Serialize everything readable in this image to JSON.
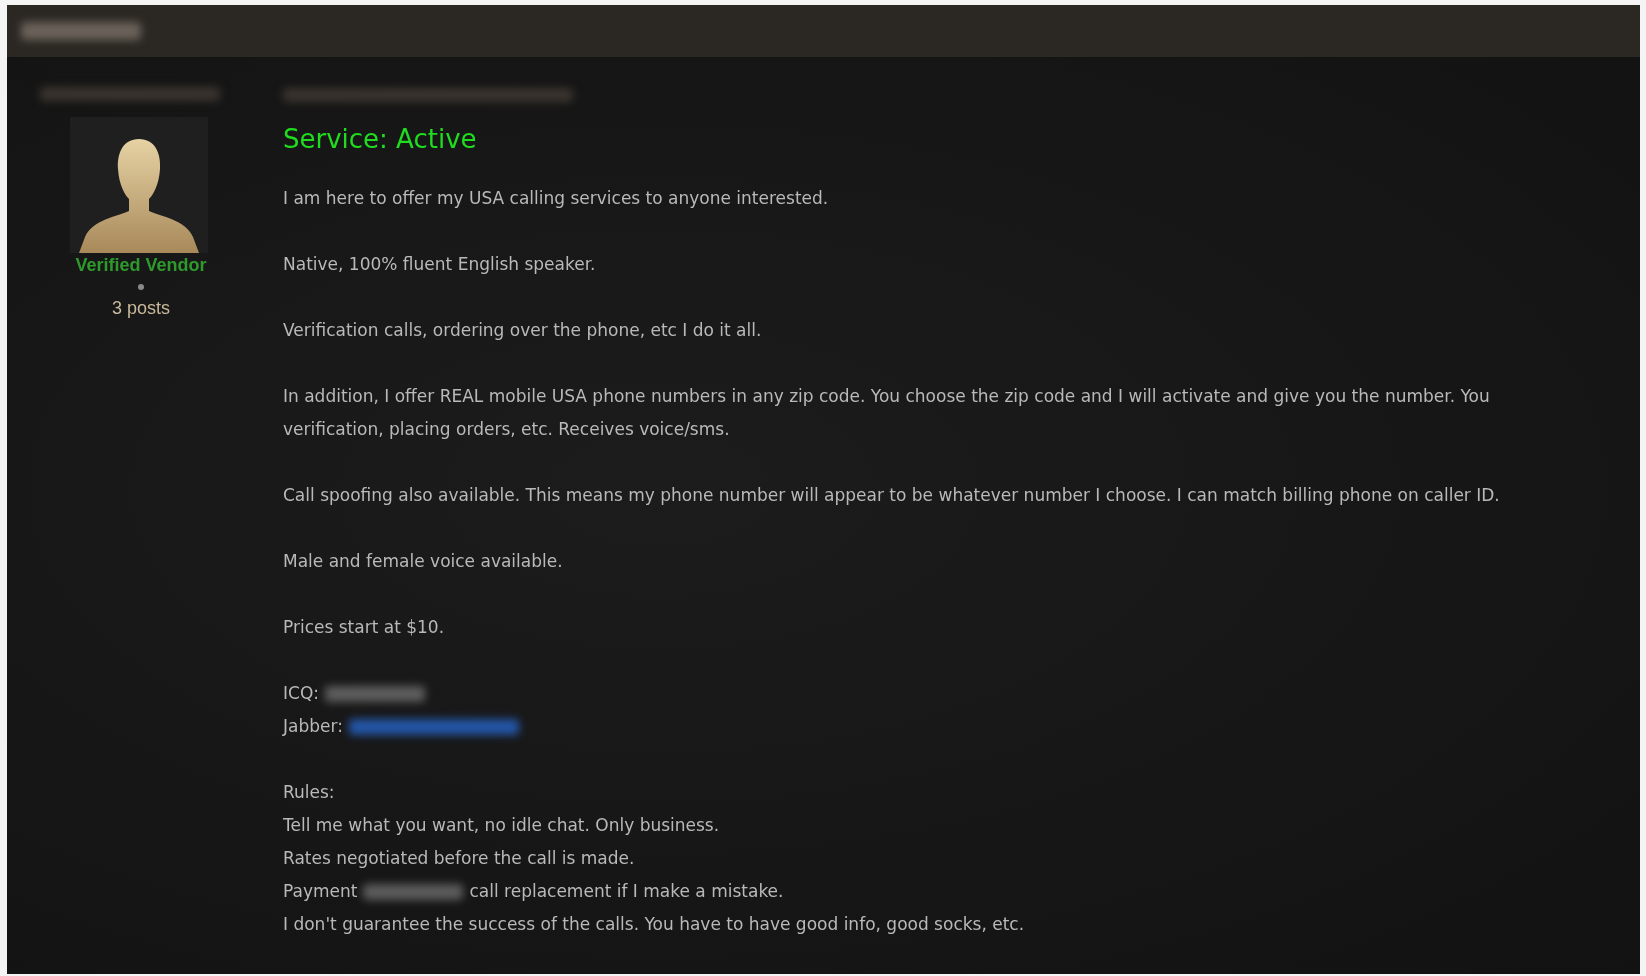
{
  "author": {
    "rank": "Verified Vendor",
    "post_count": "3 posts"
  },
  "post": {
    "title": "Service: Active",
    "paragraphs": [
      [
        "I am here to offer my USA calling services to anyone interested."
      ],
      [
        "Native, 100% fluent English speaker."
      ],
      [
        "Verification calls, ordering over the phone, etc I do it all."
      ],
      [
        "In addition, I offer REAL mobile USA phone numbers in any zip code. You choose the zip code and I will activate and give you the number. You",
        "verification, placing orders, etc. Receives voice/sms."
      ],
      [
        "Call spoofing also available. This means my phone number will appear to be whatever number I choose. I can match billing phone on caller ID."
      ],
      [
        "Male and female voice available."
      ],
      [
        "Prices start at $10."
      ],
      [
        [
          {
            "kind": "text",
            "text": "ICQ:"
          },
          {
            "kind": "redacted"
          }
        ],
        [
          {
            "kind": "text",
            "text": "Jabber:"
          },
          {
            "kind": "redacted_link"
          }
        ]
      ],
      [
        "Rules:",
        "Tell me what you want, no idle chat. Only business.",
        "Rates negotiated before the call is made.",
        [
          {
            "kind": "text",
            "text": "Payment"
          },
          {
            "kind": "redacted"
          },
          {
            "kind": "text",
            "text": "call replacement if I make a mistake."
          }
        ],
        "I don't guarantee the success of the calls. You have to have good info, good socks, etc."
      ]
    ]
  }
}
